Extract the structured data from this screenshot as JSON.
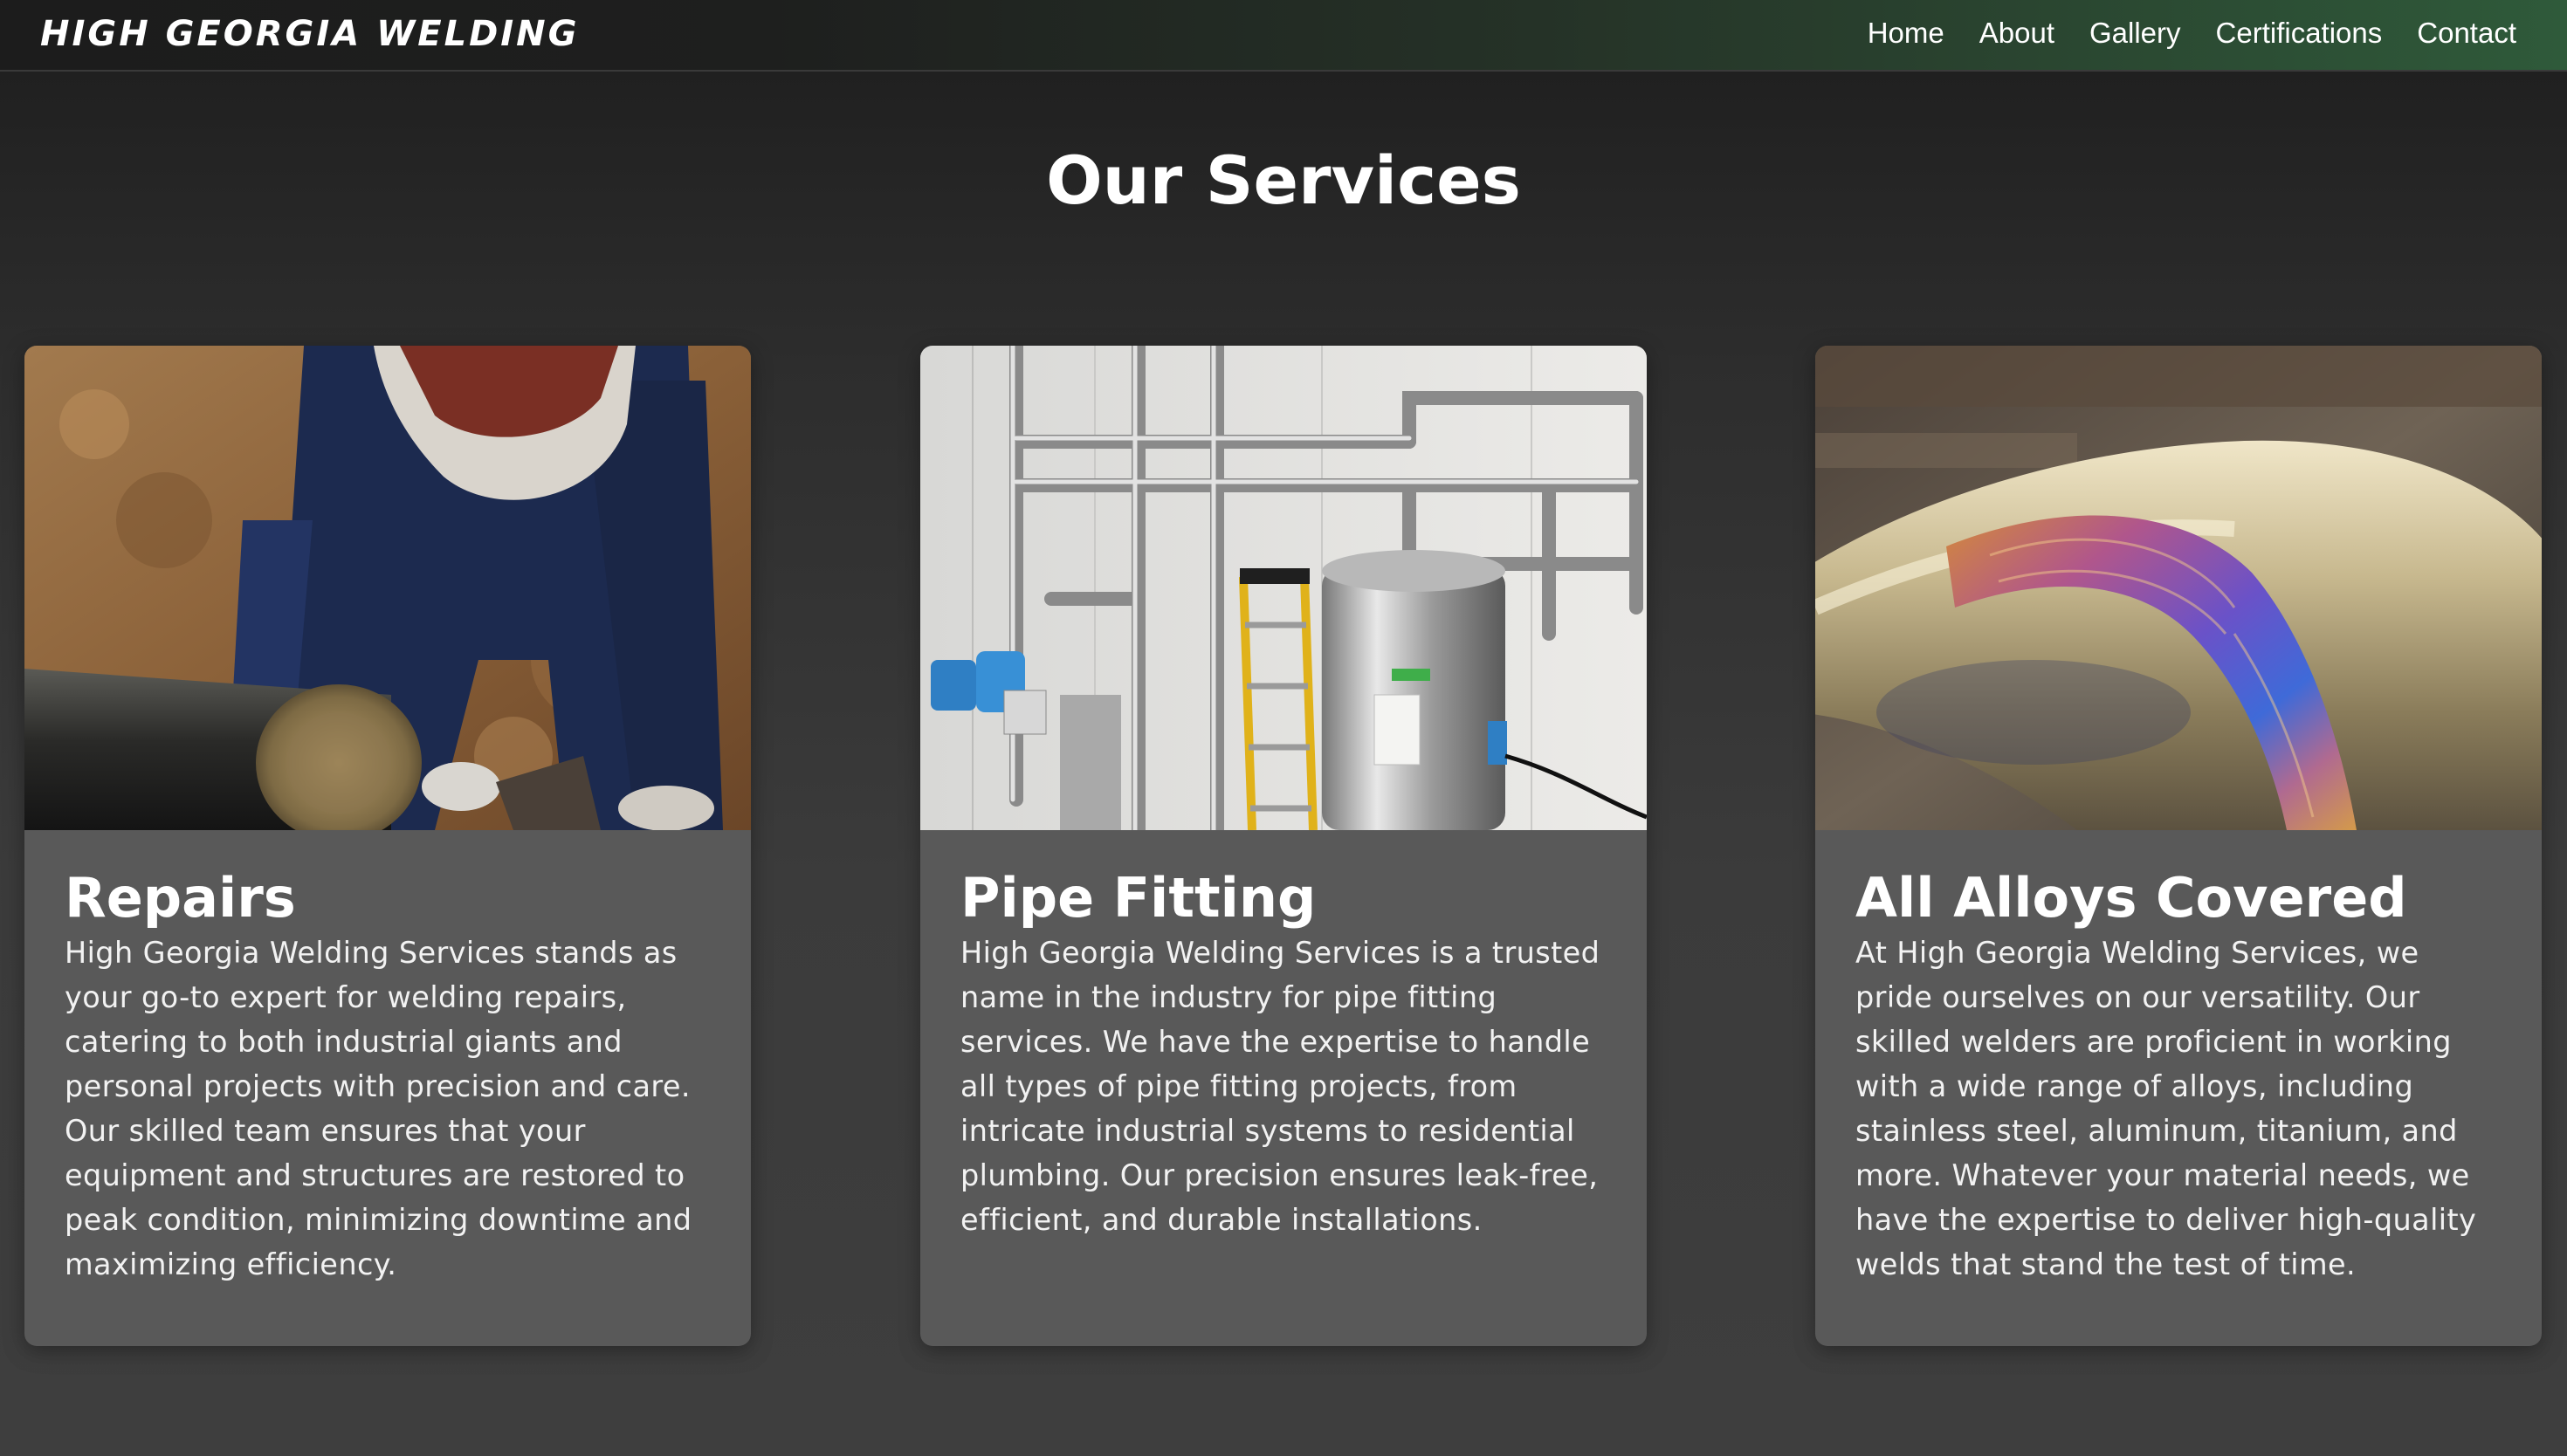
{
  "nav": {
    "brand": "HIGH GEORGIA WELDING",
    "links": [
      "Home",
      "About",
      "Gallery",
      "Certifications",
      "Contact"
    ]
  },
  "page": {
    "title": "Our Services"
  },
  "services": [
    {
      "title": "Repairs",
      "text": "High Georgia Welding Services stands as your go-to expert for welding repairs, catering to both industrial giants and personal projects with precision and care. Our skilled team ensures that your equipment and structures are restored to peak condition, minimizing downtime and maximizing efficiency."
    },
    {
      "title": "Pipe Fitting",
      "text": "High Georgia Welding Services is a trusted name in the industry for pipe fitting services. We have the expertise to handle all types of pipe fitting projects, from intricate industrial systems to residential plumbing. Our precision ensures leak-free, efficient, and durable installations."
    },
    {
      "title": "All Alloys Covered",
      "text": "At High Georgia Welding Services, we pride ourselves on our versatility. Our skilled welders are proficient in working with a wide range of alloys, including stainless steel, aluminum, titanium, and more. Whatever your material needs, we have the expertise to deliver high-quality welds that stand the test of time."
    }
  ]
}
